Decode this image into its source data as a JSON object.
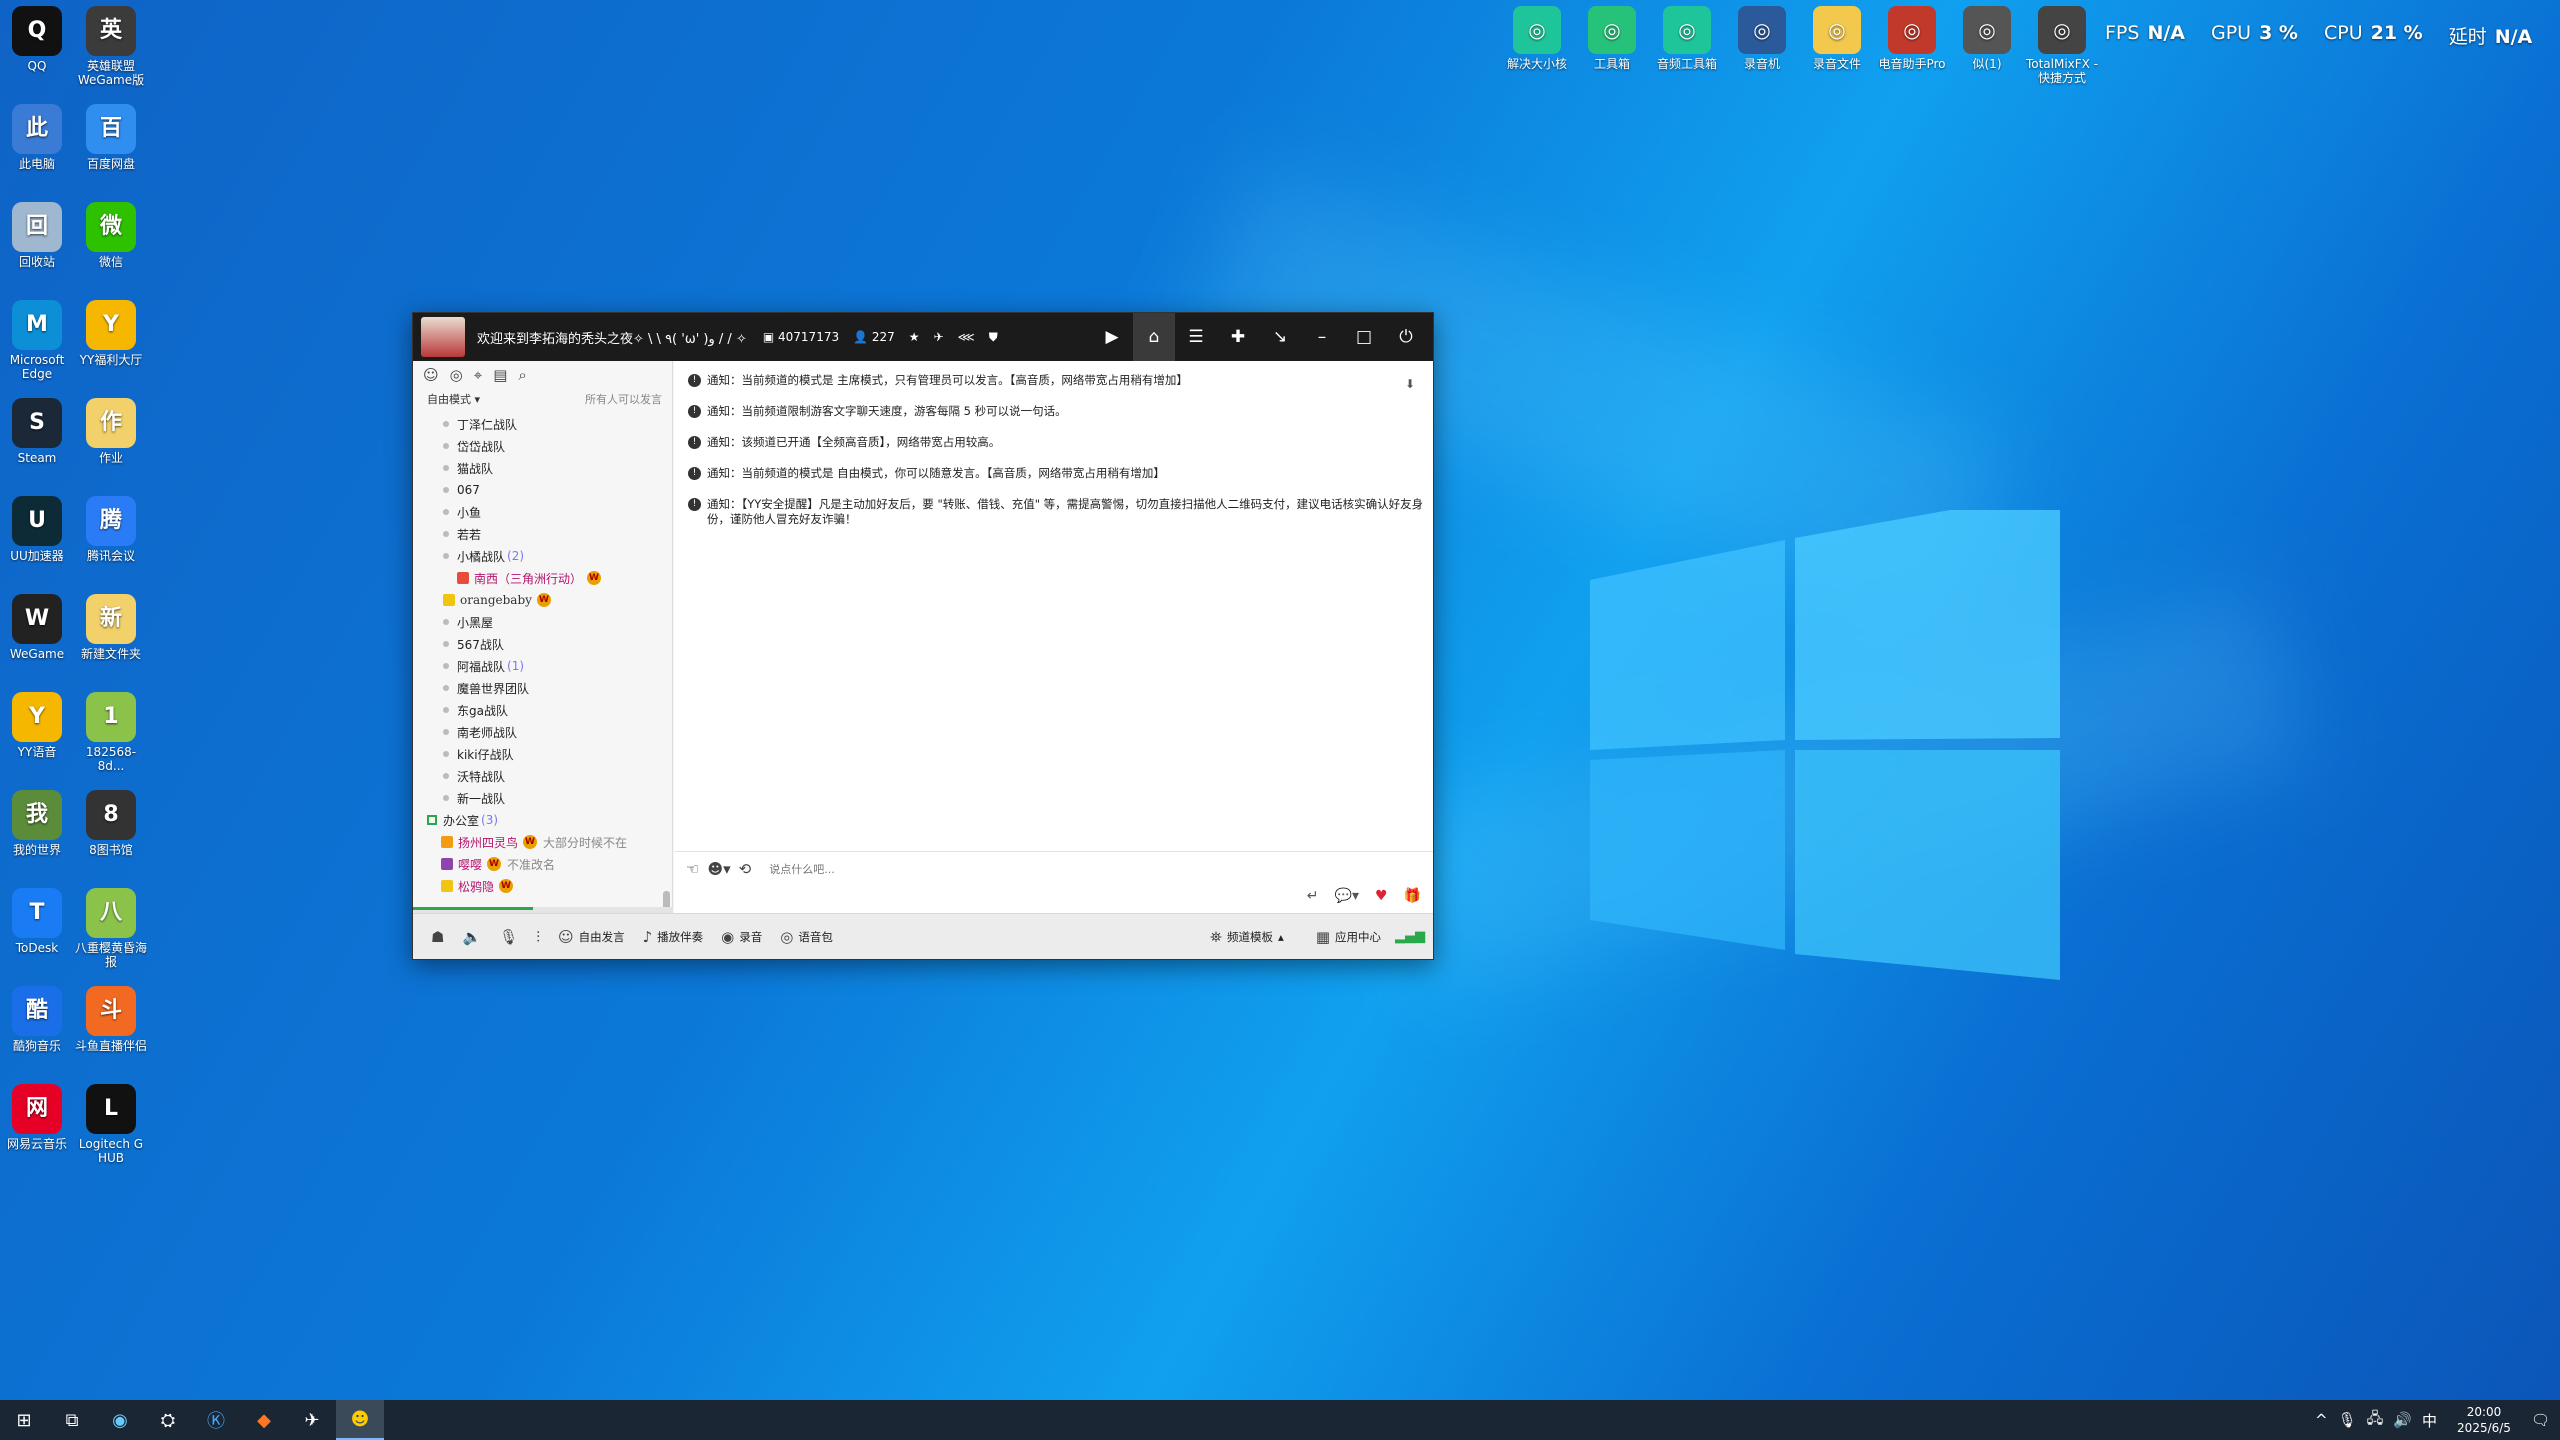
{
  "desktop_icons": [
    {
      "label": "QQ",
      "icon": "qq-penguin-icon",
      "color": "#111"
    },
    {
      "label": "英雄联盟 WeGame版",
      "icon": "lol-icon",
      "color": "#3b3b3b"
    },
    {
      "label": "此电脑",
      "icon": "computer-icon",
      "color": "#3a7bd5"
    },
    {
      "label": "百度网盘",
      "icon": "baidu-netdisk-icon",
      "color": "#2f8ef0"
    },
    {
      "label": "回收站",
      "icon": "recycle-bin-icon",
      "color": "#9fb8d0"
    },
    {
      "label": "微信",
      "icon": "wechat-icon",
      "color": "#2dc100"
    },
    {
      "label": "Microsoft Edge",
      "icon": "edge-icon",
      "color": "#0c8fd6"
    },
    {
      "label": "YY福利大厅",
      "icon": "yy-bear-icon",
      "color": "#f5b700"
    },
    {
      "label": "Steam",
      "icon": "steam-icon",
      "color": "#1b2838"
    },
    {
      "label": "作业",
      "icon": "folder-icon",
      "color": "#f2d16b"
    },
    {
      "label": "UU加速器",
      "icon": "uu-accelerator-icon",
      "color": "#0d2b36"
    },
    {
      "label": "腾讯会议",
      "icon": "tencent-meeting-icon",
      "color": "#2a7cf6"
    },
    {
      "label": "WeGame",
      "icon": "wegame-icon",
      "color": "#222"
    },
    {
      "label": "新建文件夹",
      "icon": "folder-icon",
      "color": "#f2d16b"
    },
    {
      "label": "YY语音",
      "icon": "yy-bear-icon",
      "color": "#f5b700"
    },
    {
      "label": "182568-8d...",
      "icon": "file-icon",
      "color": "#8bc34a"
    },
    {
      "label": "我的世界",
      "icon": "minecraft-icon",
      "color": "#5b8c3a"
    },
    {
      "label": "8图书馆",
      "icon": "book-icon",
      "color": "#333"
    },
    {
      "label": "ToDesk",
      "icon": "todesk-icon",
      "color": "#1a7cf5"
    },
    {
      "label": "八重樱黄昏海报",
      "icon": "file-icon",
      "color": "#8bc34a"
    },
    {
      "label": "酷狗音乐",
      "icon": "kugou-icon",
      "color": "#1a6fe8"
    },
    {
      "label": "斗鱼直播伴侣",
      "icon": "douyu-icon",
      "color": "#f26a22"
    },
    {
      "label": "网易云音乐",
      "icon": "netease-music-icon",
      "color": "#e60026"
    },
    {
      "label": "Logitech G HUB",
      "icon": "logitech-icon",
      "color": "#111"
    }
  ],
  "top_icons": [
    {
      "label": "解决大小核",
      "color": "#1fc59a"
    },
    {
      "label": "工具箱",
      "color": "#27c27a"
    },
    {
      "label": "音频工具箱",
      "color": "#1fc59a"
    },
    {
      "label": "录音机",
      "color": "#2a5a9a"
    },
    {
      "label": "录音文件",
      "color": "#f2c94c"
    },
    {
      "label": "电音助手Pro",
      "color": "#c0392b"
    },
    {
      "label": "似(1)",
      "color": "#555"
    },
    {
      "label": "TotalMixFX - 快捷方式",
      "color": "#444"
    }
  ],
  "stats": {
    "fps_label": "FPS",
    "fps_value": "N/A",
    "gpu_label": "GPU",
    "gpu_value": "3 %",
    "cpu_label": "CPU",
    "cpu_value": "21 %",
    "latency_label": "延时",
    "latency_value": "N/A"
  },
  "yy": {
    "title": "欢迎来到李拓海的秃头之夜✧ \\ \\ ٩( 'ω' )و / / ✧",
    "channel_id": "40717173",
    "online_count": "227",
    "left_mode": "自由模式",
    "left_mode_note": "所有人可以发言",
    "channels": [
      {
        "name": "丁泽仁战队",
        "type": "ch"
      },
      {
        "name": "岱岱战队",
        "type": "ch"
      },
      {
        "name": "猫战队",
        "type": "ch"
      },
      {
        "name": "067",
        "type": "ch"
      },
      {
        "name": "小鱼",
        "type": "ch"
      },
      {
        "name": "若若",
        "type": "ch"
      },
      {
        "name": "小橘战队",
        "count": "(2)",
        "type": "ch"
      },
      {
        "name": "南西（三角洲行动）",
        "type": "sub"
      },
      {
        "name": "orangebaby",
        "type": "sub2"
      },
      {
        "name": "小黑屋",
        "type": "ch"
      },
      {
        "name": "567战队",
        "type": "ch"
      },
      {
        "name": "阿福战队",
        "count": "(1)",
        "type": "ch"
      },
      {
        "name": "魔兽世界团队",
        "type": "ch"
      },
      {
        "name": "东ga战队",
        "type": "ch"
      },
      {
        "name": "南老师战队",
        "type": "ch"
      },
      {
        "name": "kiki仔战队",
        "type": "ch"
      },
      {
        "name": "沃特战队",
        "type": "ch"
      },
      {
        "name": "新一战队",
        "type": "ch"
      },
      {
        "name": "办公室",
        "count": "(3)",
        "type": "office"
      },
      {
        "name": "扬州四灵鸟",
        "extra": "大部分时候不在",
        "type": "mem",
        "role": "#f39c12"
      },
      {
        "name": "嘤嘤",
        "extra": "不准改名",
        "type": "mem",
        "role": "#8e44ad"
      },
      {
        "name": "松鸦隐",
        "type": "mem",
        "role": "#f1c40f"
      }
    ],
    "messages": [
      "通知：当前频道的模式是 主席模式，只有管理员可以发言。【高音质，网络带宽占用稍有增加】",
      "通知：当前频道限制游客文字聊天速度，游客每隔 5 秒可以说一句话。",
      "通知：该频道已开通【全频高音质】，网络带宽占用较高。",
      "通知：当前频道的模式是 自由模式，你可以随意发言。【高音质，网络带宽占用稍有增加】",
      "通知：【YY安全提醒】凡是主动加好友后，要 \"转账、借钱、充值\" 等，需提高警惕，切勿直接扫描他人二维码支付，建议电话核实确认好友身份，谨防他人冒充好友诈骗！"
    ],
    "input_placeholder": "说点什么吧...",
    "bottom": {
      "free_speak": "自由发言",
      "play_music": "播放伴奏",
      "record": "录音",
      "voice_pack": "语音包",
      "channel_template": "频道模板",
      "app_center": "应用中心"
    }
  },
  "clock": {
    "time": "20:00",
    "date": "2025/6/5"
  },
  "tray": {
    "ime": "中"
  }
}
